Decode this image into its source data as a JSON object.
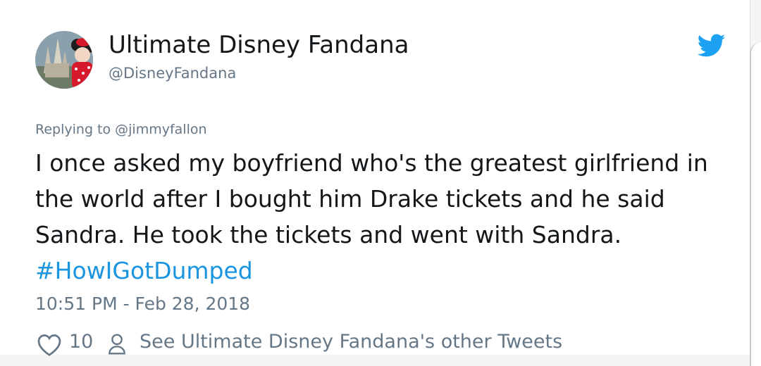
{
  "tweet": {
    "display_name": "Ultimate Disney Fandana",
    "handle": "@DisneyFandana",
    "replying_prefix": "Replying to ",
    "replying_to": "@jimmyfallon",
    "text": "I once asked my boyfriend who's the greatest girlfriend in the world after I bought him Drake tickets and he said Sandra. He took the tickets and went with Sandra. ",
    "hashtag": "#HowIGotDumped",
    "timestamp": "10:51 PM - Feb 28, 2018",
    "like_count": "10",
    "other_tweets_link": "See Ultimate Disney Fandana's other Tweets"
  },
  "icons": {
    "brand": "twitter-bird-icon",
    "like": "heart-icon",
    "profile": "person-icon"
  },
  "colors": {
    "text": "#14171a",
    "secondary": "#657786",
    "link": "#1b95e0",
    "twitter_blue": "#1da1f2"
  }
}
